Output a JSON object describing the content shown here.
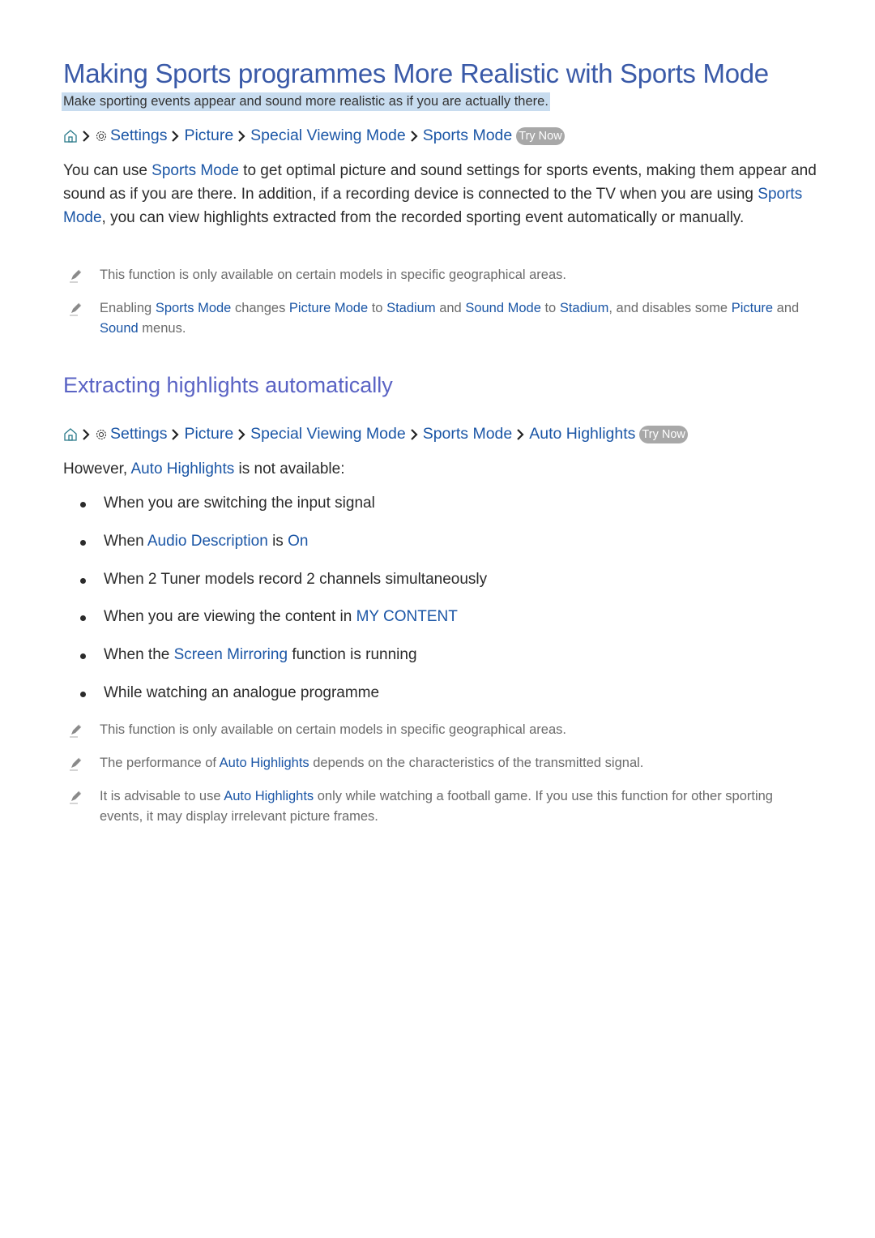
{
  "title": "Making Sports programmes More Realistic with Sports Mode",
  "subtitle": "Make sporting events appear and sound more realistic as if you are actually there.",
  "breadcrumb1": {
    "items": [
      "Settings",
      "Picture",
      "Special Viewing Mode",
      "Sports Mode"
    ],
    "try_now": "Try Now"
  },
  "intro": {
    "t1": "You can use ",
    "l1": "Sports Mode",
    "t2": " to get optimal picture and sound settings for sports events, making them appear and sound as if you are there. In addition, if a recording device is connected to the TV when you are using ",
    "l2": "Sports Mode",
    "t3": ", you can view highlights extracted from the recorded sporting event automatically or manually."
  },
  "notes1": [
    {
      "text": "This function is only available on certain models in specific geographical areas."
    },
    {
      "t1": "Enabling ",
      "l1": "Sports Mode",
      "t2": " changes ",
      "l2": "Picture Mode",
      "t3": " to ",
      "l3": "Stadium",
      "t4": " and ",
      "l4": "Sound Mode",
      "t5": " to ",
      "l5": "Stadium",
      "t6": ", and disables some ",
      "l6": "Picture",
      "t7": " and ",
      "l7": "Sound",
      "t8": " menus."
    }
  ],
  "section2": {
    "heading": "Extracting highlights automatically",
    "breadcrumb": {
      "items": [
        "Settings",
        "Picture",
        "Special Viewing Mode",
        "Sports Mode",
        "Auto Highlights"
      ],
      "try_now": "Try Now"
    },
    "lead": {
      "t1": "However, ",
      "l1": "Auto Highlights",
      "t2": " is not available:"
    },
    "bullets": [
      {
        "t1": "When you are switching the input signal"
      },
      {
        "t1": "When ",
        "l1": "Audio Description",
        "t2": " is ",
        "l2": "On"
      },
      {
        "t1": "When 2 Tuner models record 2 channels simultaneously"
      },
      {
        "t1": "When you are viewing the content in ",
        "l1": "MY CONTENT"
      },
      {
        "t1": "When the ",
        "l1": "Screen Mirroring",
        "t2": " function is running"
      },
      {
        "t1": "While watching an analogue programme"
      }
    ],
    "notes": [
      {
        "t1": "This function is only available on certain models in specific geographical areas."
      },
      {
        "t1": "The performance of ",
        "l1": "Auto Highlights",
        "t2": " depends on the characteristics of the transmitted signal."
      },
      {
        "t1": "It is advisable to use ",
        "l1": "Auto Highlights",
        "t2": " only while watching a football game. If you use this function for other sporting events, it may display irrelevant picture frames."
      }
    ]
  },
  "colors": {
    "title": "#3a5aa8",
    "heading2": "#5a63c4",
    "link": "#1b56a6",
    "highlight": "#c8dcef",
    "try_now_bg": "#a8a8a8"
  }
}
